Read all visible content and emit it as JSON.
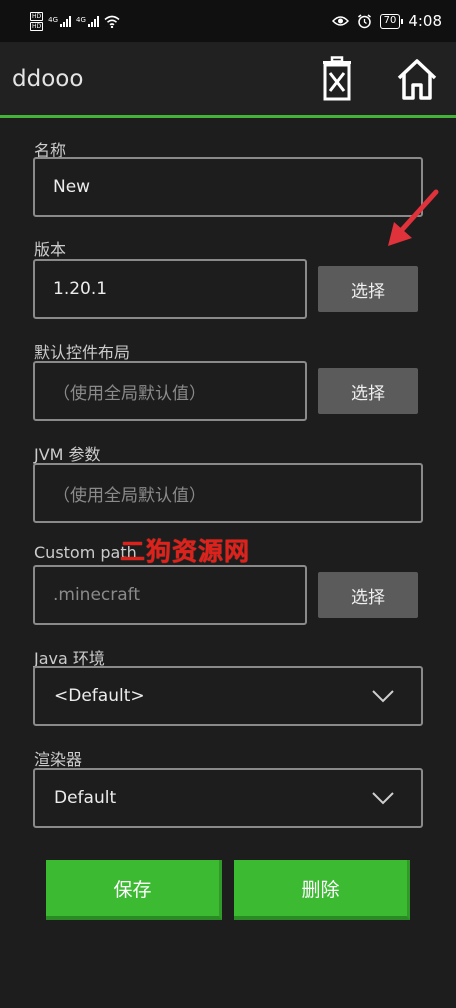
{
  "status_bar": {
    "hd_badges": [
      "HD",
      "HD"
    ],
    "network": [
      "4G",
      "4G"
    ],
    "battery": "70",
    "time": "4:08"
  },
  "toolbar": {
    "title": "ddooo",
    "delete_icon": "delete-x-icon",
    "home_icon": "home-icon"
  },
  "form": {
    "name": {
      "label": "名称",
      "value": "New"
    },
    "version": {
      "label": "版本",
      "value": "1.20.1",
      "button": "选择"
    },
    "control_layout": {
      "label": "默认控件布局",
      "placeholder": "（使用全局默认值）",
      "button": "选择"
    },
    "jvm_args": {
      "label": "JVM 参数",
      "placeholder": "（使用全局默认值）"
    },
    "custom_path": {
      "label": "Custom path",
      "placeholder": ".minecraft",
      "button": "选择"
    },
    "java_env": {
      "label": "Java 环境",
      "selected": "<Default>"
    },
    "renderer": {
      "label": "渲染器",
      "selected": "Default"
    }
  },
  "watermark": "二狗资源网",
  "actions": {
    "save": "保存",
    "delete": "删除"
  },
  "colors": {
    "accent": "#43b33a",
    "button_green": "#3bba32",
    "select_gray": "#5b5b5b",
    "arrow_red": "#e0323a"
  }
}
